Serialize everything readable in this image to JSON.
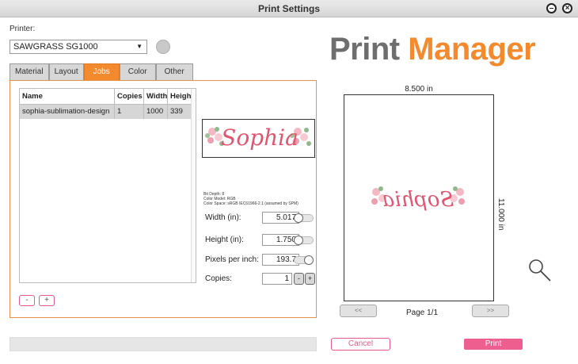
{
  "window": {
    "title": "Print Settings"
  },
  "printer": {
    "label": "Printer:",
    "selected": "SAWGRASS SG1000"
  },
  "logo": {
    "word1": "Print",
    "word2": "Manager"
  },
  "tabs": [
    {
      "label": "Material"
    },
    {
      "label": "Layout"
    },
    {
      "label": "Jobs",
      "active": true
    },
    {
      "label": "Color"
    },
    {
      "label": "Other"
    }
  ],
  "jobs_table": {
    "headers": [
      "Name",
      "Copies",
      "Width",
      "Height"
    ],
    "rows": [
      {
        "name": "sophia-sublimation-design",
        "copies": "1",
        "width": "1000",
        "height": "339"
      }
    ]
  },
  "list_buttons": {
    "remove": "-",
    "add": "+"
  },
  "image": {
    "design_text": "Sophia",
    "bit_depth": "Bit Depth: 8",
    "color_model": "Color Model: RGB",
    "color_space": "Color Space: sRGB IEC61966-2.1 (assumed by SPM)"
  },
  "fields": {
    "width": {
      "label": "Width (in):",
      "value": "5.017"
    },
    "height": {
      "label": "Height (in):",
      "value": "1.750"
    },
    "ppi": {
      "label": "Pixels per inch:",
      "value": "193.7"
    },
    "copies": {
      "label": "Copies:",
      "value": "1",
      "minus": "-",
      "plus": "+"
    }
  },
  "preview": {
    "width_label": "8.500 in",
    "height_label": "11.000 in",
    "prev": "<<",
    "next": ">>",
    "page": "Page 1/1"
  },
  "actions": {
    "cancel": "Cancel",
    "print": "Print"
  },
  "colors": {
    "accent_orange": "#f38a2e",
    "accent_pink": "#ee5e8e",
    "logo_gray": "#6e6e6e"
  },
  "icons": {
    "minimize": "minimize-icon",
    "close": "close-icon",
    "zoom": "magnifier-icon"
  }
}
